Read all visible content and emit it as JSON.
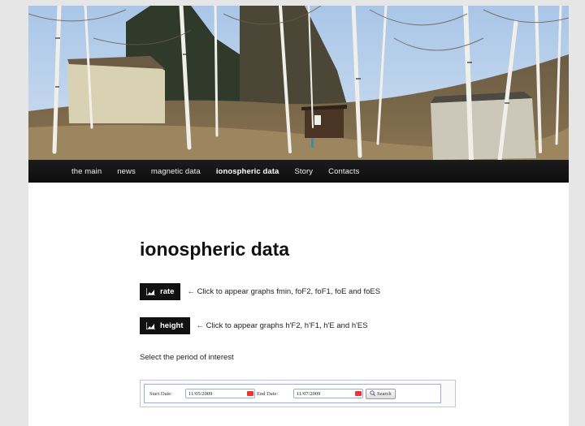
{
  "header": {
    "image_alt": "forest"
  },
  "nav": {
    "items": [
      {
        "label": "the main"
      },
      {
        "label": "news"
      },
      {
        "label": "magnetic data"
      },
      {
        "label": "ionospheric data",
        "active": true
      },
      {
        "label": "Story"
      },
      {
        "label": "Contacts"
      }
    ]
  },
  "main": {
    "title": "ionospheric data",
    "rate_button": "rate",
    "rate_hint": "← Click to appear graphs fmin, foF2, foF1, foE and foES",
    "height_button": "height",
    "height_hint": "← Click to appear graphs h'F2, h'F1, h'E and h'ES",
    "period_text": "Select the period of interest"
  },
  "form": {
    "start_label": "Start Date:",
    "start_value": "11/05/2009",
    "end_label": "End Date:",
    "end_value": "11/07/2009",
    "search_label": "Search"
  },
  "colors": {
    "nav_bg": "#111111",
    "button_bg": "#111111",
    "page_bg": "#e6e6e6"
  }
}
